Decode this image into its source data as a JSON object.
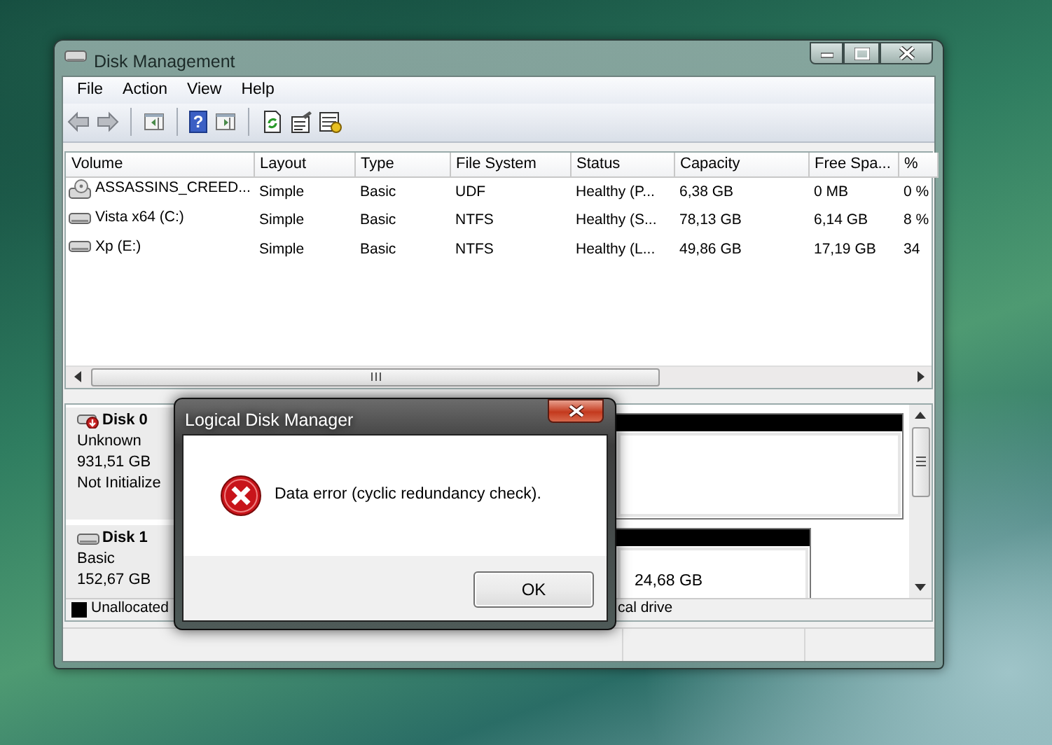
{
  "window": {
    "title": "Disk Management"
  },
  "menu": [
    "File",
    "Action",
    "View",
    "Help"
  ],
  "toolbar": {
    "help_glyph": "?"
  },
  "volumes": {
    "columns": [
      "Volume",
      "Layout",
      "Type",
      "File System",
      "Status",
      "Capacity",
      "Free Spa...",
      "%"
    ],
    "rows": [
      {
        "kind": "optical",
        "cells": [
          "ASSASSINS_CREED...",
          "Simple",
          "Basic",
          "UDF",
          "Healthy (P...",
          "6,38 GB",
          "0 MB",
          "0 %"
        ]
      },
      {
        "kind": "disk",
        "cells": [
          "Vista x64 (C:)",
          "Simple",
          "Basic",
          "NTFS",
          "Healthy (S...",
          "78,13 GB",
          "6,14 GB",
          "8 %"
        ]
      },
      {
        "kind": "disk",
        "cells": [
          "Xp (E:)",
          "Simple",
          "Basic",
          "NTFS",
          "Healthy (L...",
          "49,86 GB",
          "17,19 GB",
          "34"
        ]
      }
    ]
  },
  "disks": [
    {
      "kind": "not_initialized",
      "name": "Disk 0",
      "lines": [
        "Unknown",
        "931,51 GB",
        "Not Initialize"
      ],
      "partitions": [
        {
          "color": "#000000"
        }
      ]
    },
    {
      "kind": "basic",
      "name": "Disk 1",
      "lines": [
        "Basic",
        "152,67 GB"
      ],
      "partitions": [
        {
          "color": "#000000",
          "size": "24,68 GB"
        }
      ]
    }
  ],
  "legend": [
    {
      "label": "Unallocated",
      "color": "#000000"
    },
    {
      "label": "cal drive"
    }
  ],
  "dialog": {
    "title": "Logical Disk Manager",
    "kind": "error",
    "message": "Data error (cyclic redundancy check).",
    "buttons": [
      "OK"
    ]
  }
}
